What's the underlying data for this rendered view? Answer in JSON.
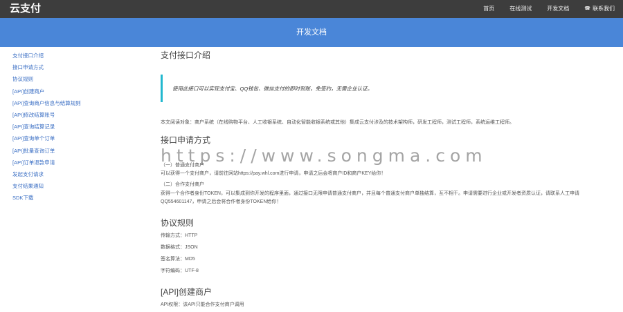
{
  "header": {
    "brand": "云支付",
    "nav": [
      {
        "label": "首页"
      },
      {
        "label": "在线测试"
      },
      {
        "label": "开发文档"
      },
      {
        "label": "联系我们",
        "icon": "phone-icon"
      }
    ]
  },
  "banner": {
    "title": "开发文档"
  },
  "sidebar": {
    "items": [
      {
        "label": "支付接口介绍"
      },
      {
        "label": "接口申请方式"
      },
      {
        "label": "协议规则"
      },
      {
        "label": "[API]创建商户"
      },
      {
        "label": "[API]查询商户信息与结算规则"
      },
      {
        "label": "[API]修改结算账号"
      },
      {
        "label": "[API]查询结算记录"
      },
      {
        "label": "[API]查询单个订单"
      },
      {
        "label": "[API]批量查询订单"
      },
      {
        "label": "[API]订单退款申请"
      },
      {
        "label": "发起支付请求"
      },
      {
        "label": "支付结果通知"
      },
      {
        "label": "SDK下载"
      }
    ]
  },
  "main": {
    "intro_title": "支付接口介绍",
    "intro_quote": "使用此接口可以实现支付宝、QQ钱包、微信支付的即时到账，免签约，无需企业认证。",
    "audience": "本文阅读对象：商户系统（在线购物平台、人工收银系统、自动化智能收银系统或其他）集成云支付涉及的技术架构师，研发工程师，测试工程师，系统运维工程师。",
    "apply_title": "接口申请方式",
    "apply_1_title": "（一）普通支付商户",
    "apply_1_text": "可以获得一个支付商户，请前往网站https://pay.whl.com进行申请，申请之后会将商户ID和商户KEY给你！",
    "apply_2_title": "（二）合作支付商户",
    "apply_2_text_1": "获得一个合作者身份TOKEN，可以集成到你开发的程序里面，通过接口无限申请普通支付商户，并且每个普通支付商户单独结算，互不相干。申请需要进行企业或开发者资质认证，请联系人工申请",
    "apply_2_text_2": "QQ554601147，申请之后会将合作者身份TOKEN给你！",
    "protocol_title": "协议规则",
    "protocol_rules": [
      "传输方式：HTTP",
      "数据格式：JSON",
      "签名算法：MD5",
      "字符编码：UTF-8"
    ],
    "create_title": "[API]创建商户",
    "create_auth": "API权限：该API只能合作支付商户调用"
  },
  "watermark": "https://www.songma.com"
}
